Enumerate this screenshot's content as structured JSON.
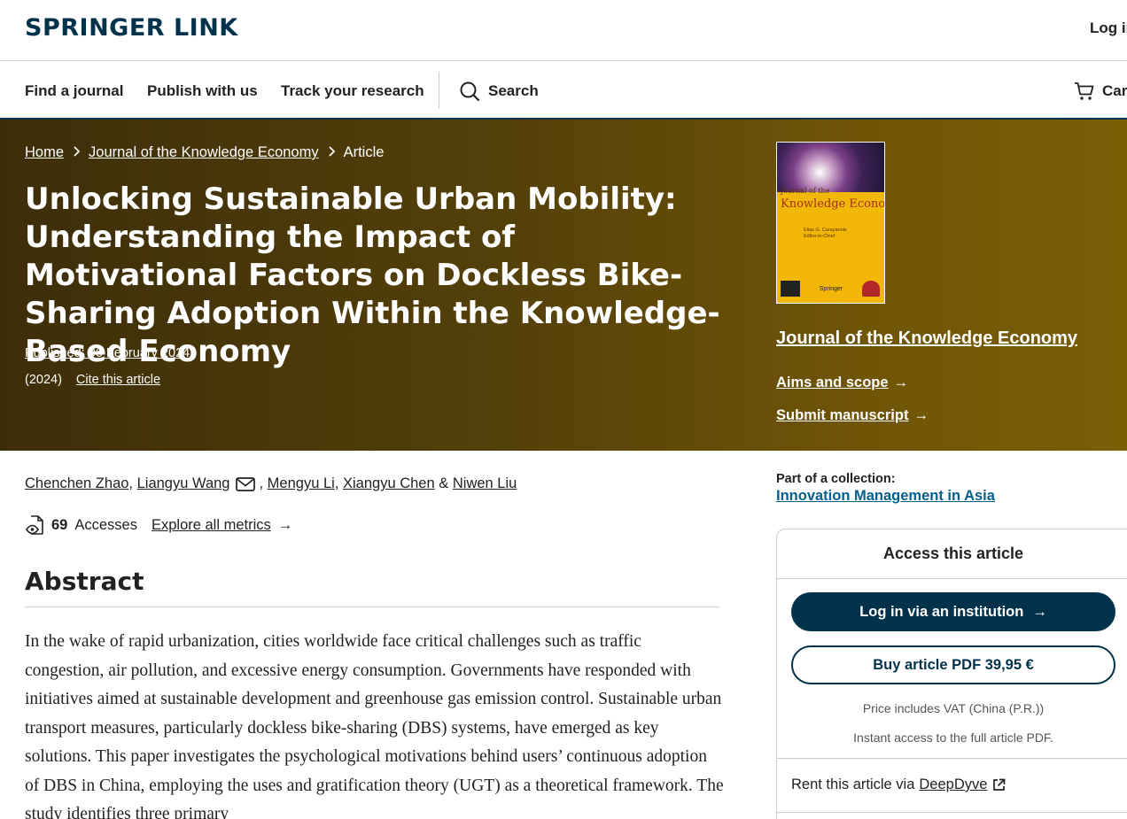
{
  "header": {
    "logo_text": "SPRINGER LINK",
    "login_label": "Log in"
  },
  "nav": {
    "items": [
      {
        "label": "Find a journal"
      },
      {
        "label": "Publish with us"
      },
      {
        "label": "Track your research"
      }
    ],
    "search_label": "Search",
    "cart_label": "Cart"
  },
  "breadcrumb": {
    "home": "Home",
    "journal": "Journal of the Knowledge Economy",
    "current": "Article"
  },
  "article": {
    "title": "Unlocking Sustainable Urban Mobility: Understanding the Impact of Motivational Factors on Dockless Bike-Sharing Adoption Within the Knowledge-Based Economy",
    "published": "Published: 06 February 2024",
    "year": "(2024)",
    "cite_label": "Cite this article",
    "authors": [
      {
        "name": "Chenchen Zhao",
        "sep": ","
      },
      {
        "name": "Liangyu Wang",
        "sep": ","
      },
      {
        "name": "Mengyu Li",
        "sep": ","
      },
      {
        "name": "Xiangyu Chen",
        "sep": "&"
      },
      {
        "name": "Niwen Liu",
        "sep": ""
      }
    ],
    "accesses_count": "69",
    "accesses_label": "Accesses",
    "metrics_link": "Explore all metrics",
    "abstract_heading": "Abstract",
    "abstract_text": "In the wake of rapid urbanization, cities worldwide face critical challenges such as traffic congestion, air pollution, and excessive energy consumption. Governments have responded with initiatives aimed at sustainable development and greenhouse gas emission control. Sustainable urban transport measures, particularly dockless bike-sharing (DBS) systems, have emerged as key solutions. This paper investigates the psychological motivations behind users’ continuous adoption of DBS in China, employing the uses and gratification theory (UGT) as a theoretical framework. The study identifies three primary"
  },
  "journal_cover": {
    "journal_of": "Journal of the",
    "name": "Knowledge Economy",
    "editor": "Elias G. Carayannis",
    "editor_role": "Editor-in-Chief",
    "publisher": "Springer"
  },
  "sidebar": {
    "journal_name": "Journal of the Knowledge Economy",
    "aims_label": "Aims and scope",
    "submit_label": "Submit manuscript",
    "collection_label": "Part of a collection:",
    "collection_name": "Innovation Management in Asia"
  },
  "access": {
    "title": "Access this article",
    "institution_label": "Log in via an institution",
    "buy_label": "Buy article PDF 39,95 €",
    "vat_note": "Price includes VAT (China (P.R.))",
    "instant_note": "Instant access to the full article PDF.",
    "rent_prefix": "Rent this article via",
    "rent_link": "DeepDyve"
  },
  "colors": {
    "brand_dark": "#01324b",
    "link_blue": "#025e8d",
    "hero_start": "#3d2e0a",
    "hero_end": "#7c5e07",
    "cover_yellow": "#f2b707"
  },
  "icons": [
    "search-icon",
    "cart-icon",
    "mail-icon",
    "accesses-icon",
    "chevron-right-icon",
    "arrow-right-icon",
    "external-link-icon"
  ]
}
